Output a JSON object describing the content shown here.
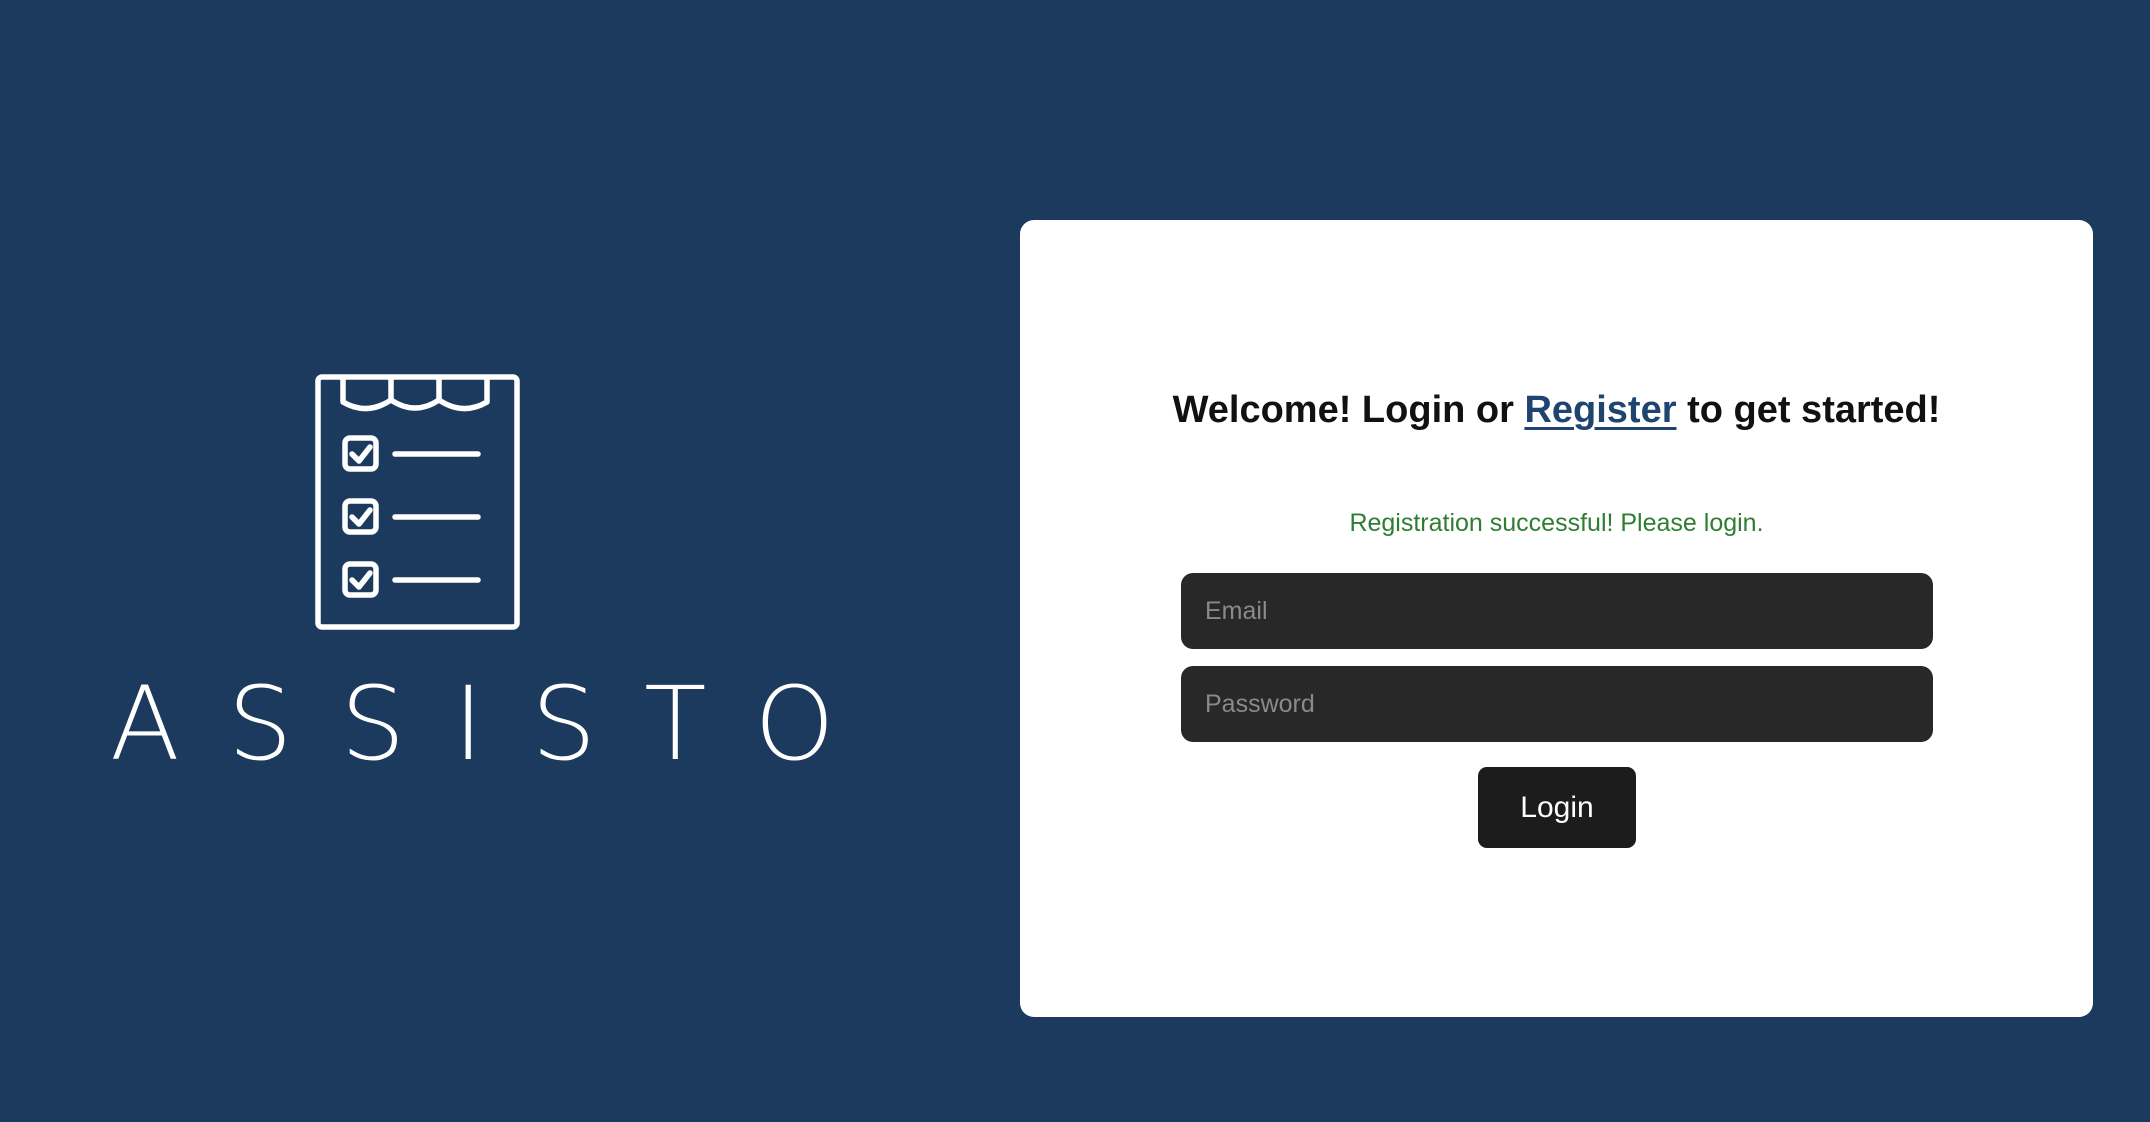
{
  "brand": {
    "logo_icon": "clipboard-checklist-icon",
    "name": "ASSISTO"
  },
  "login_card": {
    "heading_prefix": "Welcome! Login or ",
    "register_link": "Register",
    "heading_suffix": " to get started!",
    "success_message": "Registration successful! Please login.",
    "email_placeholder": "Email",
    "email_value": "",
    "password_placeholder": "Password",
    "password_value": "",
    "login_button": "Login"
  },
  "colors": {
    "background": "#1b3a5e",
    "card": "#ffffff",
    "link": "#1f4470",
    "success": "#2e7d32",
    "input_background": "#282828",
    "button_background": "#1c1c1c"
  }
}
